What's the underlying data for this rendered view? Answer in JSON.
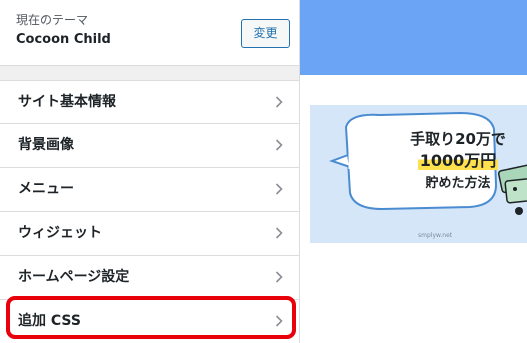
{
  "theme": {
    "label": "現在のテーマ",
    "name": "Cocoon Child",
    "change_label": "変更"
  },
  "menu": [
    {
      "label": "サイト基本情報",
      "icon": "chevron-right-icon"
    },
    {
      "label": "背景画像",
      "icon": "chevron-right-icon"
    },
    {
      "label": "メニュー",
      "icon": "chevron-right-icon"
    },
    {
      "label": "ウィジェット",
      "icon": "chevron-right-icon"
    },
    {
      "label": "ホームページ設定",
      "icon": "chevron-right-icon"
    },
    {
      "label": "追加 CSS",
      "icon": "chevron-right-icon"
    }
  ],
  "highlighted_item": "追加 CSS",
  "banner": {
    "line1": "手取り20万で",
    "line2": "1000万円",
    "line3": "貯めた方法",
    "site": "smplyw.net"
  },
  "colors": {
    "preview_header": "#6ba3f5",
    "highlight": "#e8000b",
    "accent": "#2271b1",
    "banner_bg": "#d4e6f7"
  }
}
